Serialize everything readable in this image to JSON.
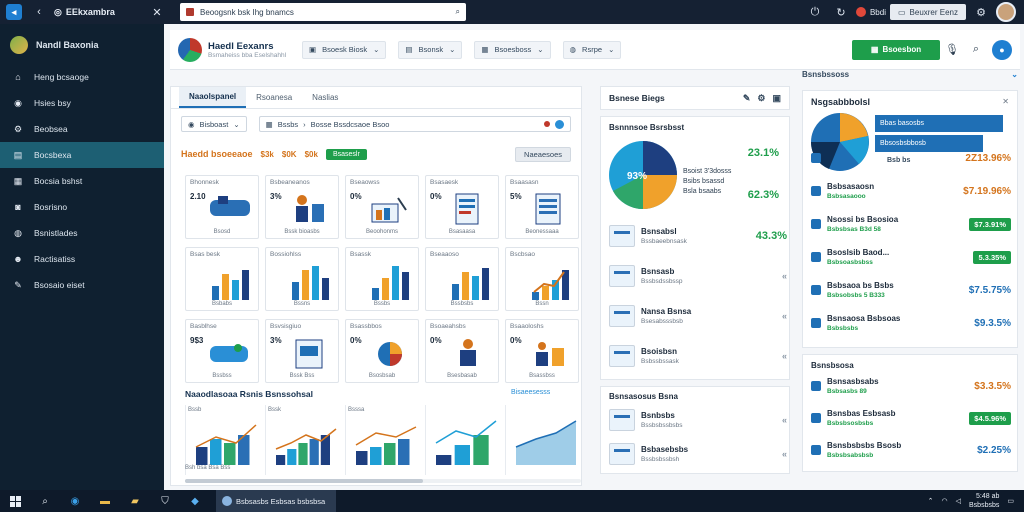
{
  "browser": {
    "tab_title": "EEkxambra",
    "url": "Beoogsnk bsk Ihg bnamcs",
    "right_pill": "Beuxrer Eenz",
    "right_label": "Bbdi"
  },
  "sidebar": {
    "user_name": "Nandl Baxonia",
    "items": [
      {
        "label": "Heng bcsaoge",
        "icon": "home-icon"
      },
      {
        "label": "Hsies bsy",
        "icon": "circle-icon"
      },
      {
        "label": "Beobsea",
        "icon": "settings-icon"
      },
      {
        "label": "Bocsbexa",
        "icon": "document-icon"
      },
      {
        "label": "Bocsia bshst",
        "icon": "calendar-icon"
      },
      {
        "label": "Bosrisno",
        "icon": "camera-icon"
      },
      {
        "label": "Bsnistlades",
        "icon": "globe-icon"
      },
      {
        "label": "Ractisatiss",
        "icon": "person-icon"
      },
      {
        "label": "Bsosaio eiset",
        "icon": "tool-icon"
      }
    ]
  },
  "topbar": {
    "brand_title": "Haedl Eexanrs",
    "brand_sub": "Bsmaheiss bba Eselshahhl",
    "select1": "Bsoesk Biosk",
    "select2": "Bsonsk",
    "select3": "Bsoesboss",
    "select4": "Rsrpe",
    "green_button": "Bsoesbon"
  },
  "center": {
    "tabs": [
      "Naaolspanel",
      "Rsoanesa",
      "Naslias"
    ],
    "filter1": "Bisboast",
    "filter2": "Bssbs",
    "filter3": "Bosse Bssdcsaoe Bsoo",
    "section_title": "Haedd bsoeeaoe",
    "stats": [
      "$3k",
      "$0K",
      "$0k"
    ],
    "section_button": "Bsaseslr",
    "section_right": "Naeaesoes",
    "tiles": [
      {
        "label": "Bhonnesk",
        "value": "2.10",
        "caption": "Bsosd"
      },
      {
        "label": "Bsbeaneanos",
        "value": "3%",
        "caption": "Bssk bioasbs"
      },
      {
        "label": "Bseaowss",
        "value": "0%",
        "caption": "Beoohonms"
      },
      {
        "label": "Bsasaesk",
        "value": "0%",
        "caption": "Bsasaasa"
      },
      {
        "label": "Bsaasasn",
        "value": "5%",
        "caption": "Beonessaaa"
      },
      {
        "label": "Bsas besk",
        "value": "",
        "caption": "Bsbabs"
      },
      {
        "label": "Bossiohlss",
        "value": "",
        "caption": "Bssns"
      },
      {
        "label": "Bsassk",
        "value": "",
        "caption": "Bssbs"
      },
      {
        "label": "Bseaaoso",
        "value": "",
        "caption": "Bssbsbs"
      },
      {
        "label": "Bscbsao",
        "value": "",
        "caption": "Bssn"
      },
      {
        "label": "Basblhse",
        "value": "9$3",
        "caption": "Bssbss"
      },
      {
        "label": "Bsvsisgiuo",
        "value": "3%",
        "caption": "Bssk Bss"
      },
      {
        "label": "Bsassbbos",
        "value": "0%",
        "caption": "Bsosbsab"
      },
      {
        "label": "Bsoaeahsbs",
        "value": "0%",
        "caption": "Bsesbasab"
      },
      {
        "label": "Bsaaoloshs",
        "value": "0%",
        "caption": "Bsassbss"
      }
    ],
    "bottom_title": "Naaodlasoaa Rsnis Bsnssohsal",
    "bottom_link": "Bisaeesesss",
    "bottom_labels": "Bsh bsa    Bsa    Bss",
    "mini_labels": [
      "Bssb",
      "Bssk",
      "Bsssa",
      "",
      ""
    ]
  },
  "mid": {
    "card1_title": "Bsnese Biegs",
    "card2_title": "Bsnnnsoe Bsrsbsst",
    "donut_label": "93%",
    "caption_lines": [
      "Bsoist 3'3dosss",
      "Bsibs bsassd",
      "Bsla bsaabs"
    ],
    "pct1": "23.1%",
    "pct2": "62.3%",
    "rows": [
      {
        "t1": "Bsnsabsl",
        "t2": "Bssbaeebnsask",
        "side": "43.3%"
      },
      {
        "t1": "Bsnsasb",
        "t2": "Bssbsdssbssp",
        "side": "«"
      },
      {
        "t1": "Nansa Bsnsa",
        "t2": "Bsesabsssbsb",
        "side": "«"
      },
      {
        "t1": "Bsoisbsn",
        "t2": "Bsbssbssask",
        "side": "«"
      }
    ],
    "card3_title": "Bsnsasosus Bsna",
    "card3_rows": [
      {
        "t1": "Bsnbsbs",
        "t2": "Bssbsbssbsbs",
        "side": "«"
      },
      {
        "t1": "Bsbasebsbs",
        "t2": "Bssbsbssbsh",
        "side": "«"
      }
    ]
  },
  "right": {
    "header": "Bsnsbssoss",
    "card1_title": "Nsgsabbbolsl",
    "bluebars": [
      "Bbas basosbs",
      "Bbsosbsbbosb"
    ],
    "donut_stat": "Bsb bs",
    "rows": [
      {
        "t1": "",
        "t2": "",
        "val": "2Z13.96%",
        "style": "orange"
      },
      {
        "t1": "Bsbsasaosn",
        "t2": "Bsbsasaooo",
        "val": "$7.19.96%",
        "style": "orange"
      },
      {
        "t1": "Nsossi bs Bsosioa",
        "t2": "Bsbsbsas B3d 58",
        "val": "$7.3.91%",
        "style": "badge"
      },
      {
        "t1": "Bsoslsib Baod...",
        "t2": "Bsbsoasbsbss",
        "val": "5.3.35%",
        "style": "badge"
      },
      {
        "t1": "Bsbsaoa bs Bsbs",
        "t2": "Bsbsobsbs 5 B333",
        "val": "$7.5.75%",
        "style": "blue"
      },
      {
        "t1": "Bsnsaosa Bsbsoas",
        "t2": "Bsbsbsbs",
        "val": "$9.3.5%",
        "style": "blue"
      }
    ],
    "card2_title": "Bsnsbsosa",
    "rows2": [
      {
        "t1": "Bsnsasbsabs",
        "t2": "Bsbsasbs 89",
        "val": "$3.3.5%",
        "style": "orange"
      },
      {
        "t1": "Bsnsbas Esbsasb",
        "t2": "Bsbsbsosbsbs",
        "val": "$4.5.96%",
        "style": "badge"
      },
      {
        "t1": "Bsnsbsbsbs Bsosb",
        "t2": "Bsbsbsabsbsb",
        "val": "$2.25%",
        "style": "blue"
      }
    ]
  },
  "taskbar": {
    "task_label": "Bsbsasbs Esbsas bsbsbsa",
    "clock_time": "5:48 ab",
    "clock_date": "Bsbsbsbs"
  },
  "colors": {
    "sidebar_bg": "#0f2030",
    "accent_green": "#1e9e4b",
    "accent_orange": "#d4741c",
    "accent_blue": "#1f6fb5"
  }
}
